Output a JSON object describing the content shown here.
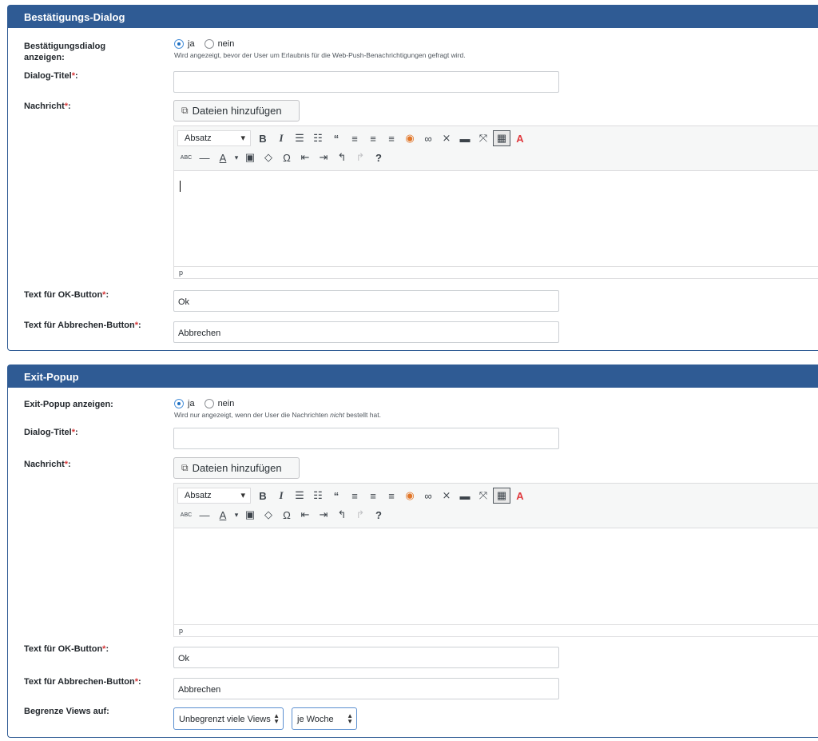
{
  "sections": [
    {
      "title": "Bestätigungs-Dialog",
      "show_label": "Bestätigungsdialog anzeigen:",
      "show_label_line1": "Bestätigungsdialog",
      "show_label_line2": "anzeigen:",
      "radio_yes": "ja",
      "radio_no": "nein",
      "selected": "ja",
      "hint": "Wird angezeigt, bevor der User um Erlaubnis für die Web-Push-Benachrichtigungen gefragt wird.",
      "dialog_title_label": "Dialog-Titel",
      "dialog_title_value": "",
      "message_label": "Nachricht",
      "media_button": "Dateien hinzufügen",
      "format_select": "Absatz",
      "status_path": "p",
      "ok_label": "Text für OK-Button",
      "ok_value": "Ok",
      "cancel_label": "Text für Abbrechen-Button",
      "cancel_value": "Abbrechen"
    },
    {
      "title": "Exit-Popup",
      "show_label": "Exit-Popup anzeigen:",
      "radio_yes": "ja",
      "radio_no": "nein",
      "selected": "ja",
      "hint_before": "Wird nur angezeigt, wenn der User die Nachrichten ",
      "hint_em": "nicht",
      "hint_after": " bestellt hat.",
      "dialog_title_label": "Dialog-Titel",
      "dialog_title_value": "",
      "message_label": "Nachricht",
      "media_button": "Dateien hinzufügen",
      "format_select": "Absatz",
      "status_path": "p",
      "ok_label": "Text für OK-Button",
      "ok_value": "Ok",
      "cancel_label": "Text für Abbrechen-Button",
      "cancel_value": "Abbrechen",
      "limit_label": "Begrenze Views auf:",
      "limit_select": "Unbegrenzt viele Views",
      "period_select": "je Woche"
    }
  ],
  "required_marker": "*",
  "label_suffix": ":",
  "colors": {
    "header_bg": "#2f5b94",
    "required": "#d63638"
  },
  "icons": {
    "media": "media-icon",
    "bold": "B",
    "italic": "I",
    "blockquote": "“",
    "special_char": "Ω",
    "help": "?"
  }
}
